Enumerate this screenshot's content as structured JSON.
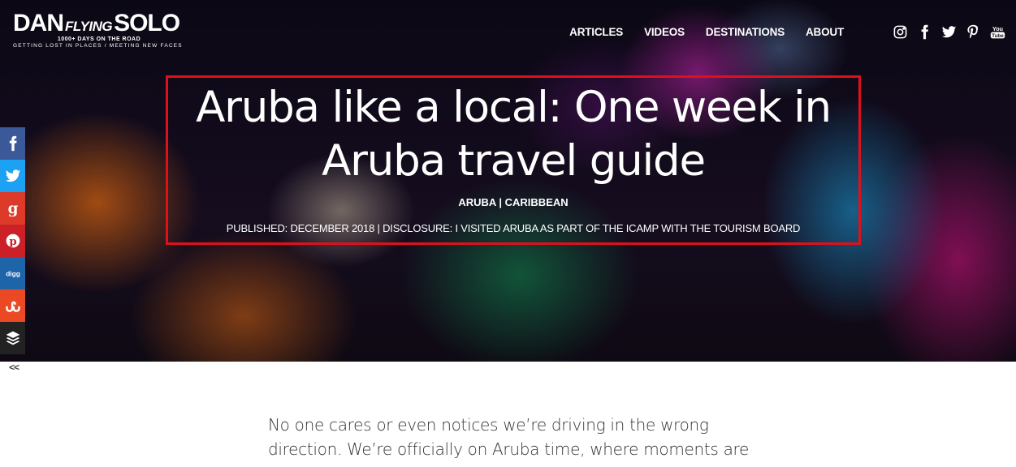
{
  "logo": {
    "dan": "DAN",
    "flying": "FLYING",
    "solo": "SOLO",
    "tagline1": "1000+ DAYS ON THE ROAD",
    "tagline2": "GETTING LOST IN PLACES / MEETING NEW FACES"
  },
  "nav": {
    "items": [
      {
        "label": "ARTICLES"
      },
      {
        "label": "VIDEOS"
      },
      {
        "label": "DESTINATIONS"
      },
      {
        "label": "ABOUT"
      }
    ]
  },
  "social": {
    "icons": [
      "instagram-icon",
      "facebook-icon",
      "twitter-icon",
      "pinterest-icon",
      "youtube-icon"
    ],
    "youtube_text": "You Tube"
  },
  "hero": {
    "title": "Aruba like a local: One week in Aruba travel guide",
    "categories": "ARUBA | CARIBBEAN",
    "published": "PUBLISHED: DECEMBER 2018 | DISCLOSURE: I VISITED ARUBA AS PART OF THE ICAMP WITH THE TOURISM BOARD",
    "highlight_color": "#e0101b"
  },
  "share": {
    "buttons": [
      {
        "icon": "facebook-icon",
        "color": "#3b5998"
      },
      {
        "icon": "twitter-icon",
        "color": "#1da1f2"
      },
      {
        "icon": "google-plus-icon",
        "color": "#dd3a2a"
      },
      {
        "icon": "pinterest-icon",
        "color": "#cb2027"
      },
      {
        "icon": "digg-icon",
        "color": "#1d64a9"
      },
      {
        "icon": "stumbleupon-icon",
        "color": "#eb4924"
      },
      {
        "icon": "buffer-icon",
        "color": "#222222"
      }
    ],
    "collapse_label": "<<"
  },
  "article": {
    "line1": "No one cares or even notices we’re driving in the wrong",
    "line2": "direction. We’re officially on Aruba time, where moments are"
  }
}
